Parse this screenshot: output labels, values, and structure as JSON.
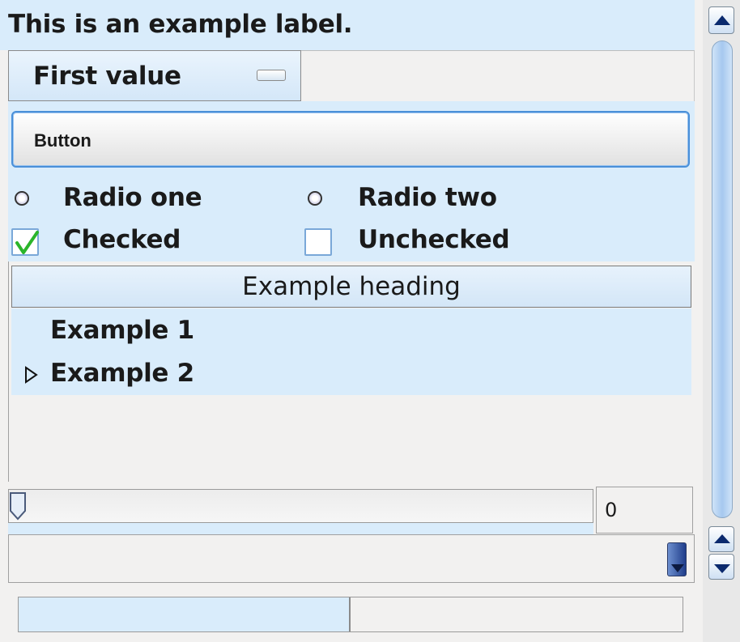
{
  "label": {
    "text": "This is an example label."
  },
  "combo": {
    "selected": "First value"
  },
  "button": {
    "label": "Button"
  },
  "radios": [
    {
      "label": "Radio one"
    },
    {
      "label": "Radio two"
    }
  ],
  "checkboxes": [
    {
      "label": "Checked",
      "checked": true
    },
    {
      "label": "Unchecked",
      "checked": false
    }
  ],
  "tree": {
    "heading": "Example heading",
    "items": [
      {
        "label": "Example 1",
        "expandable": false
      },
      {
        "label": "Example 2",
        "expandable": true
      }
    ]
  },
  "slider": {
    "value": 0
  },
  "spin": {
    "value": "0"
  },
  "progress": {
    "fraction": 0.5
  },
  "icons": {
    "scroll_up": "arrow-up-icon",
    "scroll_down": "arrow-down-icon",
    "expander": "triangle-right-icon",
    "check": "checkmark-icon"
  },
  "colors": {
    "accent": "#4a90d9",
    "highlight": "#d9ecfb",
    "check": "#2bb52b"
  }
}
